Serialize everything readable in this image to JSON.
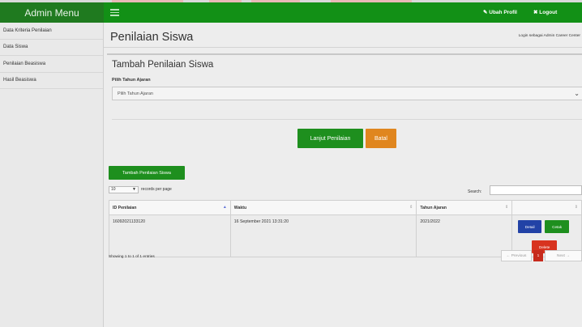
{
  "sidebar": {
    "title": "Admin Menu",
    "items": [
      {
        "label": "Data Kriteria Penilaian"
      },
      {
        "label": "Data Siswa"
      },
      {
        "label": "Penilaian Beasiswa"
      },
      {
        "label": "Hasil Beasiswa"
      }
    ]
  },
  "topbar": {
    "profile_label": "Ubah Profil",
    "logout_label": "Logout"
  },
  "main": {
    "page_title": "Penilaian Siswa",
    "login_note": "Login sebagai Admin Career Center",
    "form": {
      "title": "Tambah Penilaian Siswa",
      "year_label": "Pilih Tahun Ajaran",
      "year_selected": "Pilih Tahun Ajaran",
      "continue_label": "Lanjut Penilaian",
      "cancel_label": "Batal"
    },
    "add_button_label": "Tambah Penilaian Siswa",
    "table": {
      "page_length": "10",
      "length_text": "records per page",
      "search_label": "Search:",
      "columns": [
        "ID Penilaian",
        "Waktu",
        "Tahun Ajaran",
        ""
      ],
      "rows": [
        {
          "id": "16092021133120",
          "waktu": "16 September 2021 13:31:20",
          "tahun": "2021/2022"
        }
      ],
      "actions": {
        "detail": "Detail",
        "cetak": "Cetak",
        "delete": "Delete"
      },
      "info": "Showing 1 to 1 of 1 entries",
      "pagination": {
        "prev": "← Previous",
        "current": "1",
        "next": "Next →"
      }
    }
  },
  "colors": {
    "topbar": "#129016",
    "sidebar_head": "#1f7a1f",
    "green_button": "#1e8f1e",
    "orange_button": "#e0861f",
    "detail_button": "#2242a6",
    "delete_button": "#d8331f"
  },
  "icons": {
    "hamburger": "hamburger-icon",
    "pencil": "pencil-icon",
    "close": "close-icon"
  }
}
